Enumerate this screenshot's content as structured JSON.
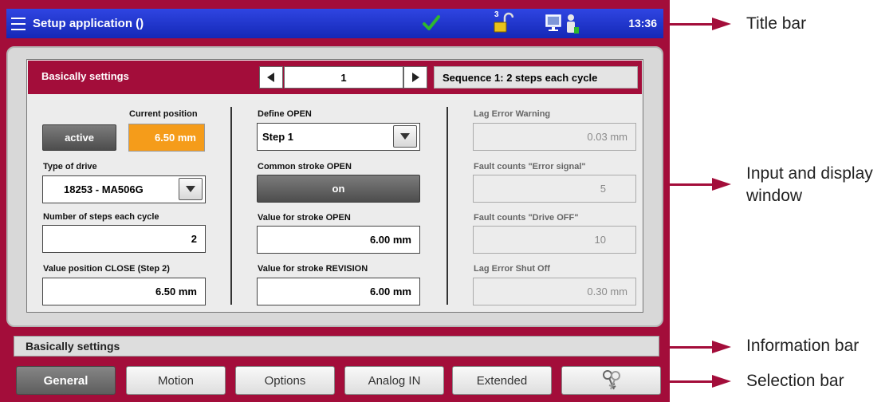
{
  "title_bar": {
    "title": "Setup application ()",
    "clock": "13:36",
    "lock_level": "3",
    "status_icons": [
      "checkmark-icon",
      "unlock-icon",
      "monitor-icon",
      "operator-icon"
    ]
  },
  "panel": {
    "title": "Basically settings",
    "sequence_number": "1",
    "sequence_description": "Sequence 1: 2 steps each cycle",
    "left": {
      "active_button": "active",
      "current_position_label": "Current position",
      "current_position_value": "6.50  mm",
      "type_of_drive_label": "Type of drive",
      "type_of_drive_value": "18253 - MA506G",
      "steps_label": "Number of steps each cycle",
      "steps_value": "2",
      "close_label": "Value position CLOSE (Step 2)",
      "close_value": "6.50  mm"
    },
    "middle": {
      "define_open_label": "Define OPEN",
      "define_open_value": "Step 1",
      "common_stroke_label": "Common stroke OPEN",
      "common_stroke_value": "on",
      "stroke_open_label": "Value for stroke OPEN",
      "stroke_open_value": "6.00  mm",
      "stroke_revision_label": "Value for stroke REVISION",
      "stroke_revision_value": "6.00  mm"
    },
    "right": {
      "lag_warning_label": "Lag Error Warning",
      "lag_warning_value": "0.03  mm",
      "fault_error_label": "Fault counts \"Error signal\"",
      "fault_error_value": "5",
      "fault_drive_label": "Fault counts \"Drive OFF\"",
      "fault_drive_value": "10",
      "lag_shutoff_label": "Lag Error Shut Off",
      "lag_shutoff_value": "0.30  mm"
    }
  },
  "info_bar": {
    "text": "Basically settings"
  },
  "selection_bar": {
    "tabs": [
      "General",
      "Motion",
      "Options",
      "Analog IN",
      "Extended"
    ],
    "active": "General",
    "keys_icon": "keys-icon"
  },
  "callouts": [
    "Title bar",
    "Input and display\nwindow",
    "Information bar",
    "Selection bar"
  ],
  "colors": {
    "frame": "#a30d3a",
    "title_bar": "#1f37d0",
    "highlight": "#f59c1a",
    "accent_green": "#2eb82e"
  }
}
